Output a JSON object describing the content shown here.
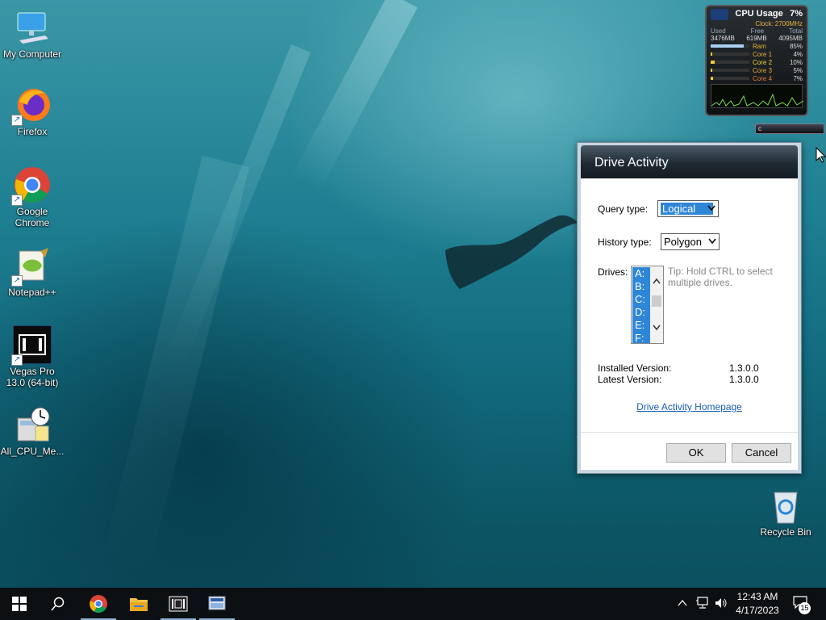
{
  "desktop": {
    "icons": [
      {
        "label": "My Computer",
        "icon": "computer-icon"
      },
      {
        "label": "Firefox",
        "icon": "firefox-icon"
      },
      {
        "label": "Google Chrome",
        "icon": "chrome-icon"
      },
      {
        "label": "Notepad++",
        "icon": "notepadpp-icon"
      },
      {
        "label": "Vegas Pro 13.0 (64-bit)",
        "icon": "vegas-pro-icon"
      },
      {
        "label": "All_CPU_Me...",
        "icon": "cpu-meter-icon"
      }
    ],
    "recycle_bin": {
      "label": "Recycle Bin",
      "icon": "recycle-bin-icon"
    }
  },
  "cpu_gadget": {
    "title": "CPU Usage",
    "percent": "7%",
    "clock": "Clock: 2700MHz",
    "mem_headers": [
      "Used",
      "Free",
      "Total"
    ],
    "mem_values": [
      "3476MB",
      "619MB",
      "4095MB"
    ],
    "rows": [
      {
        "name": "Ram",
        "value": "85%",
        "level": 0.85
      },
      {
        "name": "Core 1",
        "value": "4%",
        "level": 0.04
      },
      {
        "name": "Core 2",
        "value": "10%",
        "level": 0.1
      },
      {
        "name": "Core 3",
        "value": "5%",
        "level": 0.05
      },
      {
        "name": "Core 4",
        "value": "7%",
        "level": 0.07
      }
    ],
    "slider_text": "c"
  },
  "dialog": {
    "title": "Drive Activity",
    "query_type_label": "Query type:",
    "query_type_value": "Logical",
    "history_type_label": "History type:",
    "history_type_value": "Polygon",
    "drives_label": "Drives:",
    "drives": [
      "A:",
      "B:",
      "C:",
      "D:",
      "E:",
      "F:"
    ],
    "tip": "Tip: Hold CTRL to select multiple drives.",
    "installed_version_label": "Installed Version:",
    "installed_version": "1.3.0.0",
    "latest_version_label": "Latest Version:",
    "latest_version": "1.3.0.0",
    "homepage_link": "Drive Activity Homepage",
    "ok": "OK",
    "cancel": "Cancel"
  },
  "taskbar": {
    "time": "12:43 AM",
    "date": "4/17/2023",
    "notification_count": "15",
    "pinned": [
      "start-button",
      "search-button",
      "chrome-taskbar",
      "file-explorer-taskbar",
      "vegas-taskbar",
      "cpu-meter-taskbar"
    ]
  },
  "colors": {
    "accent": "#2e86d6",
    "link": "#1a5fb4",
    "taskbar": "#0c1013"
  }
}
